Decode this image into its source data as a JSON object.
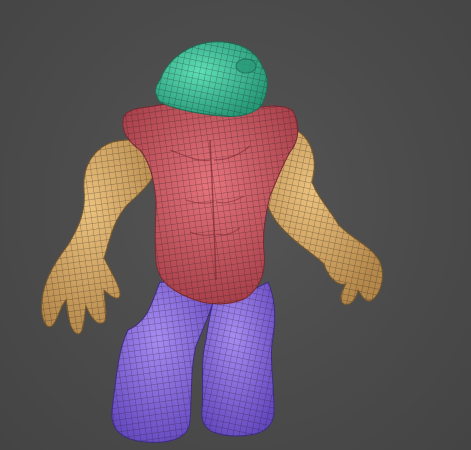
{
  "viewport": {
    "background": "#4b4b4b"
  },
  "model": {
    "polygroups": [
      {
        "part": "head",
        "color": "#3fc9a0",
        "icon": "polygroup-head"
      },
      {
        "part": "torso",
        "color": "#d9606a",
        "icon": "polygroup-torso"
      },
      {
        "part": "arms",
        "color": "#d8a866",
        "icon": "polygroup-arms"
      },
      {
        "part": "legs",
        "color": "#8c6fe0",
        "icon": "polygroup-legs"
      }
    ],
    "wireframe": true,
    "wire_color": "#1a1a1a"
  }
}
